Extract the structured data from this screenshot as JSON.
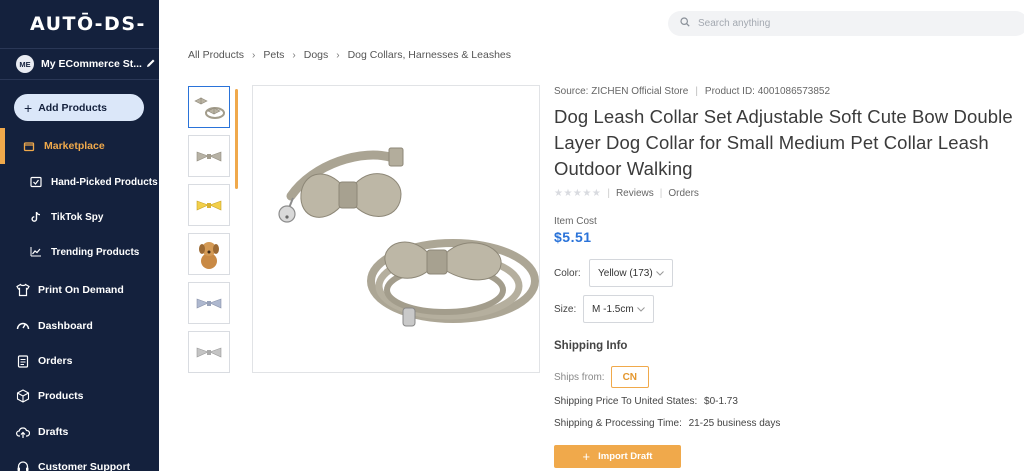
{
  "brand": {
    "logo_text": "AUTŌ-DS-"
  },
  "sidebar": {
    "store": {
      "initials": "ME",
      "name": "My ECommerce St..."
    },
    "add_button_label": "Add Products",
    "items": [
      {
        "label": "Marketplace",
        "icon": "store-icon",
        "active": true
      },
      {
        "label": "Hand-Picked Products",
        "icon": "hand-picked-icon"
      },
      {
        "label": "TikTok Spy",
        "icon": "tiktok-icon"
      },
      {
        "label": "Trending Products",
        "icon": "trending-icon"
      },
      {
        "label": "Print On Demand",
        "icon": "shirt-icon"
      },
      {
        "label": "Dashboard",
        "icon": "gauge-icon"
      },
      {
        "label": "Orders",
        "icon": "clipboard-icon"
      },
      {
        "label": "Products",
        "icon": "box-icon"
      },
      {
        "label": "Drafts",
        "icon": "upload-cloud-icon"
      },
      {
        "label": "Customer Support",
        "icon": "support-icon"
      }
    ],
    "accent_color": "#f0a94b",
    "background_color": "#14213d"
  },
  "search": {
    "placeholder": "Search anything"
  },
  "breadcrumb": [
    "All Products",
    "Pets",
    "Dogs",
    "Dog Collars, Harnesses & Leashes"
  ],
  "product": {
    "source": "Source: ZICHEN Official Store",
    "product_id": "Product ID: 4001086573852",
    "title": "Dog Leash Collar Set Adjustable Soft Cute Bow Double Layer Dog Collar for Small Medium Pet Collar Leash Outdoor Walking",
    "reviews_label": "Reviews",
    "orders_label": "Orders",
    "rating_stars": 0,
    "item_cost_label": "Item Cost",
    "item_cost": "$5.51",
    "color_label": "Color:",
    "color_value": "Yellow (173)",
    "size_label": "Size:",
    "size_value": "M -1.5cm",
    "thumbnails": [
      "grey-collar-set",
      "grey-bow",
      "yellow-bow",
      "plush-dog",
      "blue-bow",
      "grey-bow-2"
    ]
  },
  "shipping": {
    "title": "Shipping Info",
    "ships_from_label": "Ships from:",
    "ships_from_value": "CN",
    "price_label": "Shipping Price To United States:",
    "price_value": "$0-1.73",
    "time_label": "Shipping & Processing Time:",
    "time_value": "21-25 business days"
  },
  "import_button_label": "Import Draft"
}
